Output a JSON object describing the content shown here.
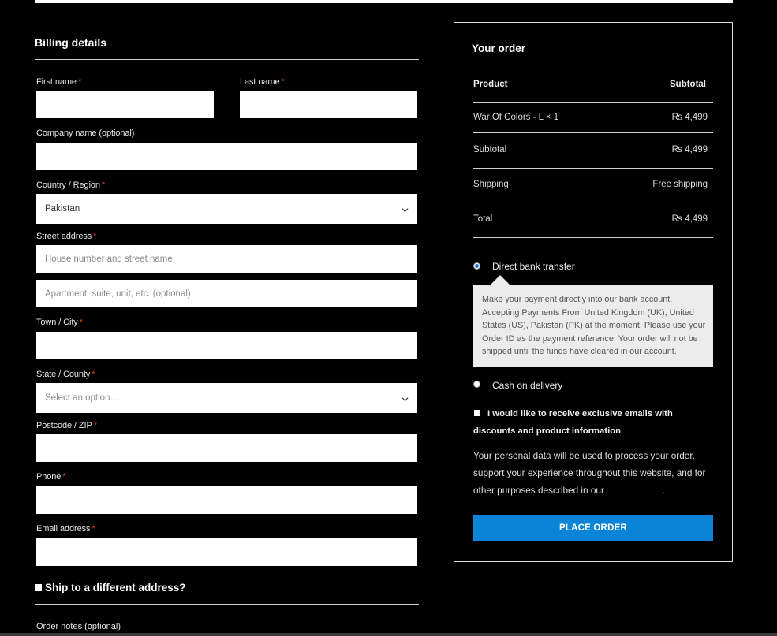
{
  "billing": {
    "title": "Billing details",
    "first_name_label": "First name",
    "last_name_label": "Last name",
    "company_label": "Company name (optional)",
    "country_label": "Country / Region",
    "country_value": "Pakistan",
    "street_label": "Street address",
    "street_placeholder": "House number and street name",
    "street2_placeholder": "Apartment, suite, unit, etc. (optional)",
    "city_label": "Town / City",
    "state_label": "State / County",
    "state_placeholder": "Select an option…",
    "postcode_label": "Postcode / ZIP",
    "phone_label": "Phone",
    "email_label": "Email address",
    "required_mark": "*"
  },
  "shipping": {
    "ship_different_label": "Ship to a different address?",
    "order_notes_label": "Order notes (optional)"
  },
  "order": {
    "title": "Your order",
    "head_product": "Product",
    "head_subtotal": "Subtotal",
    "rows": [
      {
        "label": "War Of Colors - L × 1",
        "value": "₨ 4,499"
      },
      {
        "label": "Subtotal",
        "value": "₨ 4,499"
      },
      {
        "label": "Shipping",
        "value": "Free shipping"
      },
      {
        "label": "Total",
        "value": "₨ 4,499"
      }
    ]
  },
  "payment": {
    "bank_label": "Direct bank transfer",
    "bank_description": "Make your payment directly into our bank account. Accepting Payments From United Kingdom (UK), United States (US), Pakistan (PK) at the moment. Please use your Order ID as the payment reference. Your order will not be shipped until the funds have cleared in our account.",
    "cod_label": "Cash on delivery",
    "consent_label": "I would like to receive exclusive emails with discounts and product information",
    "privacy_text": "Your personal data will be used to process your order, support your experience throughout this website, and for other purposes described in our",
    "privacy_end": ".",
    "place_order_label": "PLACE ORDER"
  },
  "colors": {
    "accent": "#0a84d6",
    "required": "#e2401c",
    "background": "#000000"
  }
}
